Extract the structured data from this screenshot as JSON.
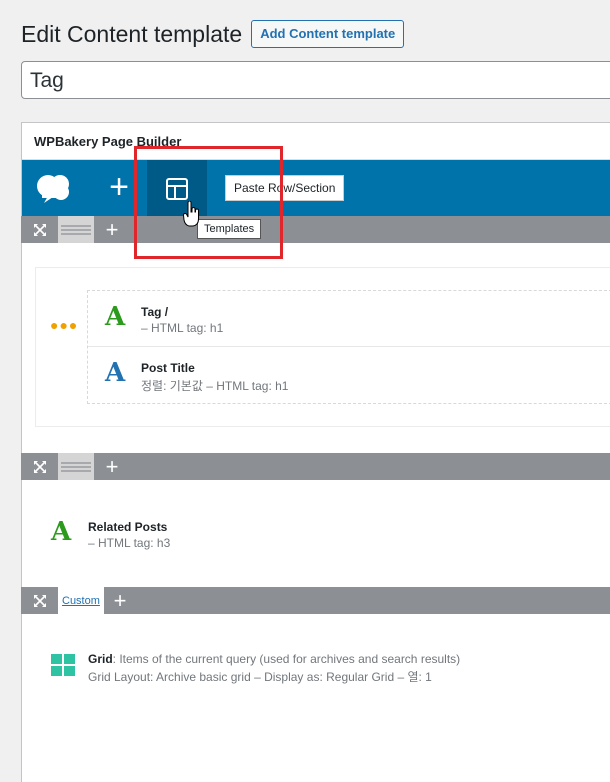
{
  "page": {
    "title": "Edit Content template",
    "add_button": "Add Content template",
    "title_value": "Tag"
  },
  "builder": {
    "title": "WPBakery Page Builder",
    "toolbar": {
      "logo_icon": "wpbakery-logo-icon",
      "add_icon": "plus-icon",
      "templates_icon": "templates-layout-icon",
      "paste_label": "Paste Row/Section",
      "tooltip": "Templates"
    }
  },
  "rows": [
    {
      "move_icon": "expand-icon",
      "columns_icon": "columns-icon",
      "add_icon": "plus-icon",
      "elements": [
        {
          "icon": "text-A-icon",
          "color": "#2c9a1d",
          "name": "Tag /",
          "sub": "– HTML tag: h1"
        },
        {
          "icon": "text-A-icon",
          "color": "#2271b1",
          "name": "Post Title",
          "sub": "정렬: 기본값  – HTML tag: h1"
        }
      ]
    },
    {
      "move_icon": "expand-icon",
      "columns_icon": "columns-icon",
      "add_icon": "plus-icon",
      "elements": [
        {
          "icon": "text-A-icon",
          "color": "#2c9a1d",
          "name": "Related Posts",
          "sub": "– HTML tag: h3"
        }
      ]
    },
    {
      "move_icon": "expand-icon",
      "custom_label": "Custom",
      "add_icon": "plus-icon",
      "elements": [
        {
          "icon": "grid-icon",
          "color": "#2ec4a3",
          "name": "Grid",
          "name_suffix": ": Items of the current query (used for archives and search results)",
          "sub": "Grid Layout: Archive basic grid  – Display as: Regular Grid  – 열: 1"
        }
      ]
    }
  ]
}
